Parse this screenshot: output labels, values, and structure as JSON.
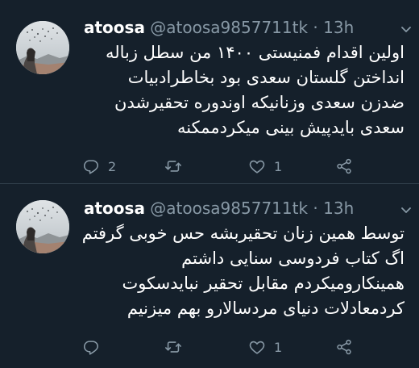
{
  "tweets": [
    {
      "name": "atoosa",
      "handle": "@atoosa9857711tk",
      "separator": "·",
      "time": "13h",
      "lines": [
        "اولین اقدام فمنیستی ۱۴۰۰ من سطل زباله",
        "انداختن گلستان سعدی بود بخاطرادبیات",
        "ضدزن سعدی وزنانیکه اوندوره تحقیرشدن",
        "سعدی بایدپیش بینی میکردممکنه"
      ],
      "replies": "2",
      "retweets": "",
      "likes": "1"
    },
    {
      "name": "atoosa",
      "handle": "@atoosa9857711tk",
      "separator": "·",
      "time": "13h",
      "lines": [
        "توسط همین زنان تحقیربشه حس خوبی گرفتم",
        "اگ کتاب فردوسی سنایی داشتم",
        "همینکارومیکردم مقابل تحقیر نبایدسکوت",
        "کردمعادلات دنیای مردسالارو بهم میزنیم"
      ],
      "replies": "",
      "retweets": "",
      "likes": "1"
    }
  ],
  "icons": {
    "reply": "reply-icon",
    "retweet": "retweet-icon",
    "like": "like-icon",
    "share": "share-icon",
    "more": "chevron-down-icon"
  },
  "colors": {
    "background": "#15202b",
    "text": "#ffffff",
    "secondary": "#8899a6",
    "divider": "#2f3d4a"
  }
}
